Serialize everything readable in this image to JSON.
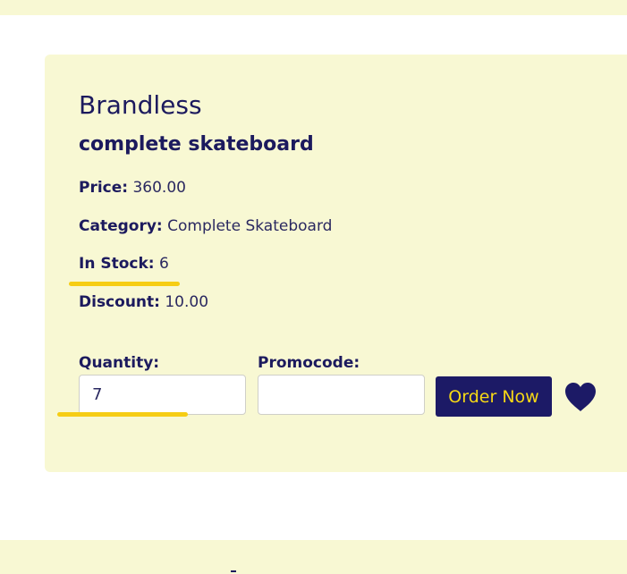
{
  "product": {
    "brand": "Brandless",
    "name": "complete skateboard",
    "price_label": "Price:",
    "price_value": "360.00",
    "category_label": "Category:",
    "category_value": "Complete Skateboard",
    "stock_label": "In Stock:",
    "stock_value": "6",
    "discount_label": "Discount:",
    "discount_value": "10.00"
  },
  "order_form": {
    "quantity_label": "Quantity:",
    "quantity_value": "7",
    "promocode_label": "Promocode:",
    "promocode_value": "",
    "order_button_label": "Order Now",
    "favorite_icon": "heart-icon"
  },
  "colors": {
    "background": "#ffffff",
    "card": "#f8f8d3",
    "text": "#1c1a5e",
    "button": "#1c1a66",
    "button_text": "#f6d815",
    "highlight": "#f6cd14"
  }
}
